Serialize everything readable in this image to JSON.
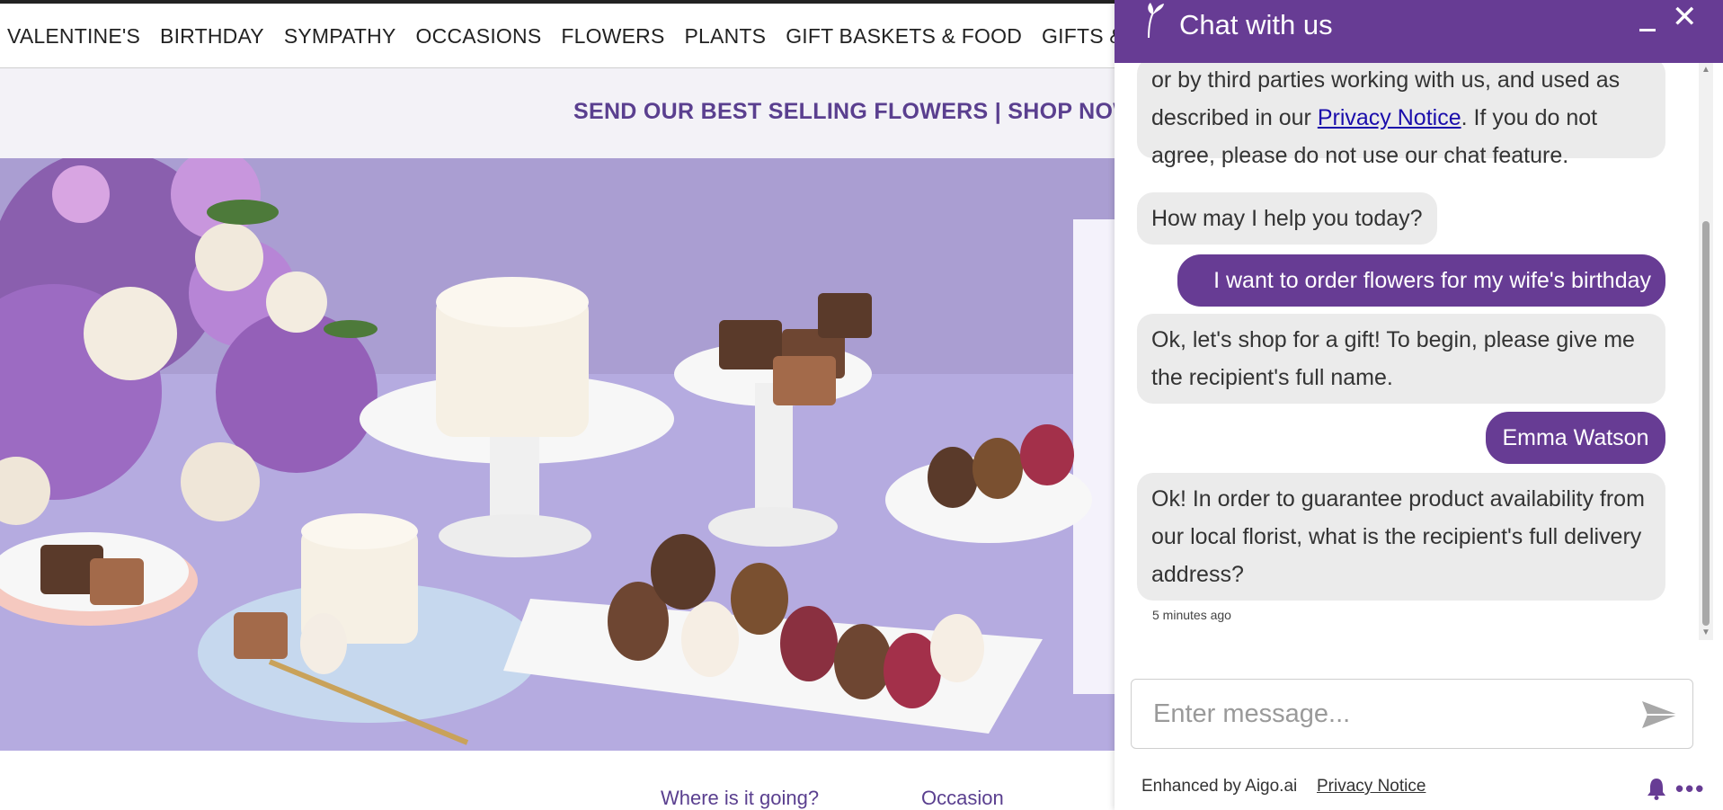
{
  "nav": {
    "items": [
      "VALENTINE'S",
      "BIRTHDAY",
      "SYMPATHY",
      "OCCASIONS",
      "FLOWERS",
      "PLANTS",
      "GIFT BASKETS & FOOD",
      "GIFTS & MORE"
    ]
  },
  "promo": {
    "text": "SEND OUR BEST SELLING FLOWERS | SHOP NOW"
  },
  "finder": {
    "where_label": "Where is it going?",
    "occasion_label": "Occasion"
  },
  "chat": {
    "title": "Chat with us",
    "messages": {
      "m0_part1": "or by third parties working with us, and used as described in our ",
      "m0_link": "Privacy Notice",
      "m0_part2": ". If you do not agree, please do not use our chat feature.",
      "m1": "How may I help you today?",
      "m2": "I want to order flowers for my wife's birthday",
      "m3": "Ok, let's shop for a gift! To begin, please give me the recipient's full name.",
      "m4": "Emma Watson",
      "m5": "Ok! In order to guarantee product availability from our local florist, what is the recipient's full delivery address?"
    },
    "timestamp": "5 minutes ago",
    "input_placeholder": "Enter message...",
    "footer": {
      "powered_by": "Enhanced by Aigo.ai",
      "privacy": "Privacy Notice"
    }
  },
  "colors": {
    "brand_purple": "#673c94",
    "promo_text": "#5a3f8f",
    "hero_bg": "#a99dd0"
  },
  "icons": [
    "logo-tulip-icon",
    "minimize-icon",
    "close-icon",
    "send-icon",
    "bell-icon",
    "more-icon"
  ]
}
